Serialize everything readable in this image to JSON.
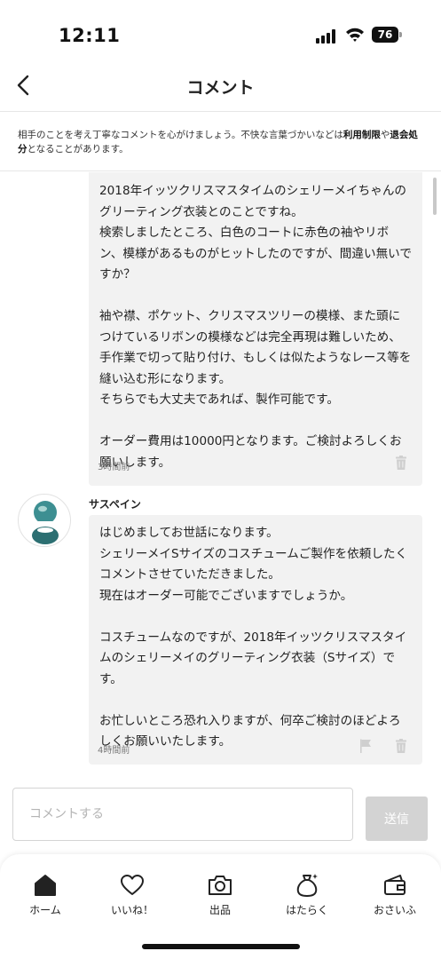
{
  "status_bar": {
    "time": "12:11",
    "battery": "76"
  },
  "header": {
    "title": "コメント"
  },
  "notice": {
    "text_1": "相手のことを考え丁寧なコメントを心がけましょう。不快な言葉づかいなどは",
    "link_1": "利用制限",
    "text_2": "や",
    "link_2": "退会処分",
    "text_3": "となることがあります。"
  },
  "comments": [
    {
      "body": "2018年イッツクリスマスタイムのシェリーメイちゃんのグリーティング衣装とのことですね。\n検索しましたところ、白色のコートに赤色の袖やリボン、模様があるものがヒットしたのですが、間違い無いですか？\n\n袖や襟、ポケット、クリスマスツリーの模様、また頭につけているリボンの模様などは完全再現は難しいため、手作業で切って貼り付け、もしくは似たようなレース等を縫い込む形になります。\nそちらでも大丈夫であれば、製作可能です。\n\nオーダー費用は10000円となります。ご検討よろしくお願いします。",
      "time": "3時間前"
    },
    {
      "author": "サスペイン",
      "body": "はじめましてお世話になります。\nシェリーメイSサイズのコスチュームご製作を依頼したくコメントさせていただきました。\n現在はオーダー可能でございますでしょうか。\n\nコスチュームなのですが、2018年イッツクリスマスタイムのシェリーメイのグリーティング衣装（Sサイズ）です。\n\nお忙しいところ恐れ入りますが、何卒ご検討のほどよろしくお願いいたします。",
      "time": "4時間前"
    }
  ],
  "input": {
    "placeholder": "コメントする",
    "send_label": "送信"
  },
  "tabs": [
    {
      "label": "ホーム",
      "icon": "home-icon"
    },
    {
      "label": "いいね！",
      "icon": "heart-icon"
    },
    {
      "label": "出品",
      "icon": "camera-icon"
    },
    {
      "label": "はたらく",
      "icon": "money-bag-icon"
    },
    {
      "label": "おさいふ",
      "icon": "wallet-icon"
    }
  ],
  "colors": {
    "send_disabled": "#d3d3d3",
    "bubble_bg": "#f2f2f2",
    "avatar_teal": "#2e8b8b"
  }
}
